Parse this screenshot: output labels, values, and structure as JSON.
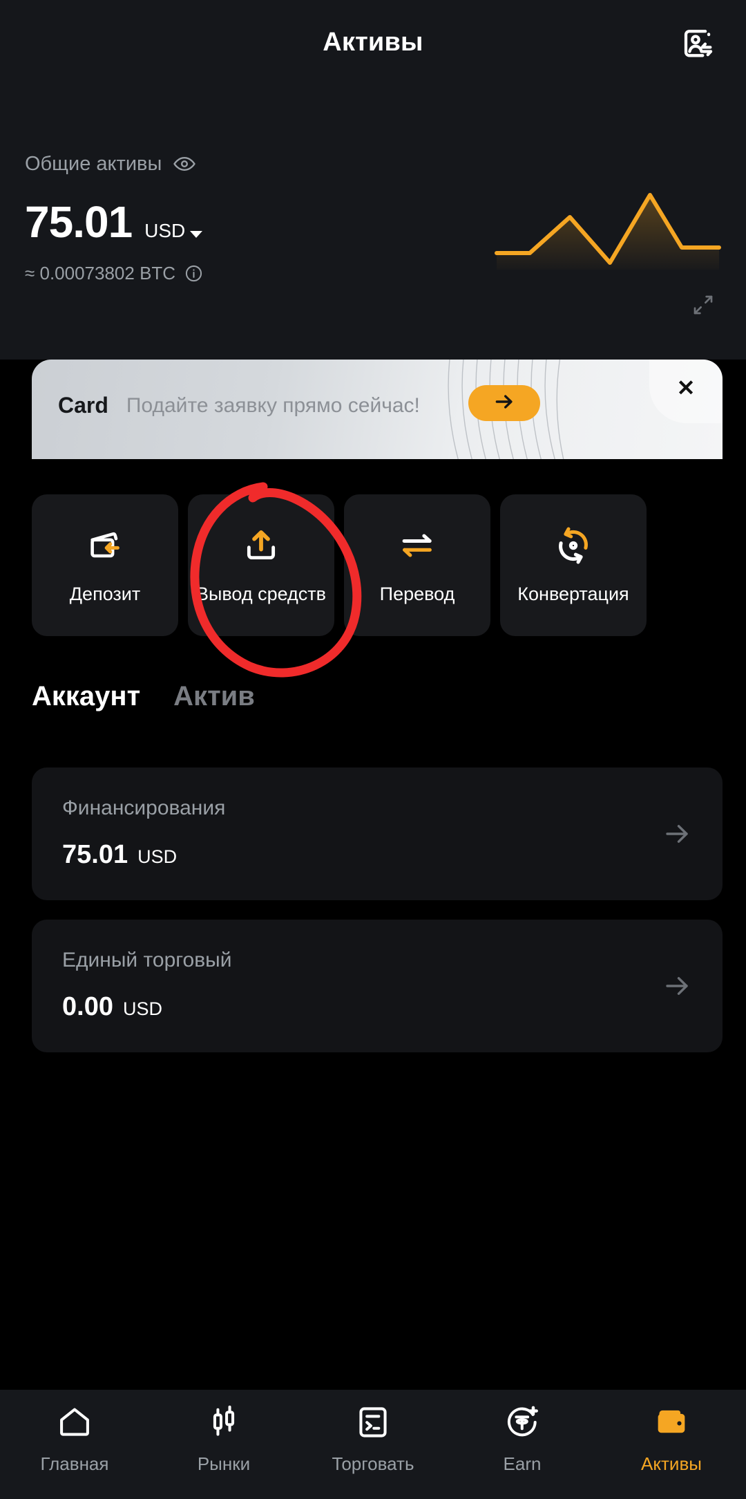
{
  "header": {
    "title": "Активы",
    "right_icon": "contacts-transfer-icon"
  },
  "balance": {
    "label": "Общие активы",
    "eye_icon": "eye-icon",
    "amount": "75.01",
    "currency": "USD",
    "currency_caret": "chevron-down-icon",
    "approx": "≈ 0.00073802 BTC",
    "info_icon": "info-icon",
    "expand_icon": "expand-icon"
  },
  "chart_data": {
    "type": "line",
    "title": "",
    "x": [
      0,
      1,
      2,
      3,
      4,
      5,
      6
    ],
    "values": [
      10,
      10,
      62,
      0,
      100,
      22,
      22
    ],
    "color": "#f5a623",
    "grid": false,
    "legend": "none",
    "xlabel": "",
    "ylabel": "",
    "ylim": [
      0,
      100
    ]
  },
  "banner": {
    "brand": "Card",
    "text": "Подайте заявку прямо сейчас!",
    "cta_icon": "arrow-right-icon",
    "close_label": "✕",
    "accent": "#f5a623"
  },
  "actions": [
    {
      "label": "Депозит",
      "icon": "wallet-deposit-icon"
    },
    {
      "label": "Вывод средств",
      "icon": "upload-withdraw-icon"
    },
    {
      "label": "Перевод",
      "icon": "transfer-arrows-icon"
    },
    {
      "label": "Конвертация",
      "icon": "convert-circular-icon"
    }
  ],
  "tabs": [
    {
      "label": "Аккаунт",
      "active": true
    },
    {
      "label": "Актив",
      "active": false
    }
  ],
  "accounts": [
    {
      "title": "Финансирования",
      "amount": "75.01",
      "currency": "USD",
      "arrow": "arrow-right-icon"
    },
    {
      "title": "Единый торговый",
      "amount": "0.00",
      "currency": "USD",
      "arrow": "arrow-right-icon"
    }
  ],
  "bottom_nav": [
    {
      "label": "Главная",
      "icon": "home-icon",
      "active": false
    },
    {
      "label": "Рынки",
      "icon": "candlestick-icon",
      "active": false
    },
    {
      "label": "Торговать",
      "icon": "trade-list-icon",
      "active": false
    },
    {
      "label": "Earn",
      "icon": "tether-plus-icon",
      "active": false
    },
    {
      "label": "Активы",
      "icon": "wallet-icon",
      "active": true
    }
  ],
  "annotation": {
    "shape": "hand-drawn-red-circle",
    "color": "#f02b2b",
    "target": "Вывод средств"
  }
}
